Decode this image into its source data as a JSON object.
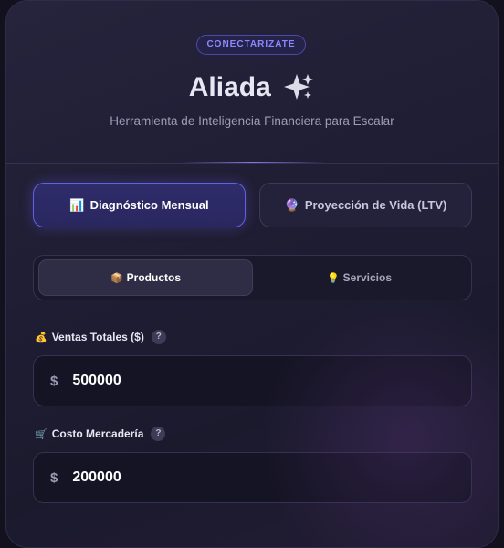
{
  "header": {
    "badge": "CONECTARIZATE",
    "title": "Aliada",
    "title_icon": "sparkle-icon",
    "subtitle": "Herramienta de Inteligencia Financiera para Escalar"
  },
  "tabs": [
    {
      "icon": "📊",
      "icon_name": "bar-chart-icon",
      "label": "Diagnóstico Mensual",
      "active": true
    },
    {
      "icon": "🔮",
      "icon_name": "crystal-ball-icon",
      "label": "Proyección de Vida (LTV)",
      "active": false
    }
  ],
  "segment": [
    {
      "icon": "📦",
      "icon_name": "package-icon",
      "label": "Productos",
      "active": true
    },
    {
      "icon": "💡",
      "icon_name": "lightbulb-icon",
      "label": "Servicios",
      "active": false
    }
  ],
  "fields": [
    {
      "icon": "💰",
      "icon_name": "money-bag-icon",
      "label": "Ventas Totales ($)",
      "help": "?",
      "currency": "$",
      "value": "500000"
    },
    {
      "icon": "🛒",
      "icon_name": "cart-icon",
      "label": "Costo Mercadería",
      "help": "?",
      "currency": "$",
      "value": "200000"
    }
  ],
  "colors": {
    "accent": "#6460e6",
    "badge_text": "#8d88ff",
    "card_bg": "#1f1d33"
  }
}
